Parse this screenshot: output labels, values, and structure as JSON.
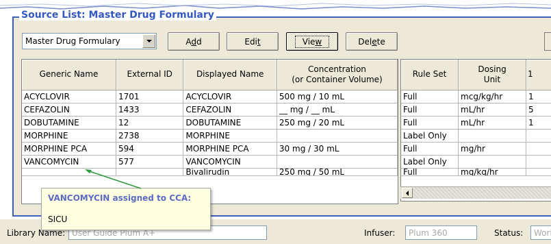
{
  "group_title": "Source List: Master Drug Formulary",
  "source_select": {
    "value": "Master Drug Formulary"
  },
  "buttons": {
    "add": {
      "pre": "A",
      "key": "d",
      "post": "d"
    },
    "edit": {
      "pre": "Edi",
      "key": "t",
      "post": ""
    },
    "view": {
      "pre": "Vie",
      "key": "w",
      "post": ""
    },
    "delete": {
      "pre": "Del",
      "key": "e",
      "post": "te"
    }
  },
  "left_table": {
    "headers": [
      "Generic Name",
      "External ID",
      "Displayed Name",
      "Concentration\n(or Container Volume)"
    ],
    "rows": [
      [
        "ACYCLOVIR",
        "1701",
        "ACYCLOVIR",
        "500 mg / 10 mL"
      ],
      [
        "CEFAZOLIN",
        "1433",
        "CEFAZOLIN",
        "__ mg / __ mL"
      ],
      [
        "DOBUTAMINE",
        "12",
        "DOBUTAMINE",
        "250 mg / 20 mL"
      ],
      [
        "MORPHINE",
        "2738",
        "MORPHINE",
        ""
      ],
      [
        "MORPHINE PCA",
        "594",
        "MORPHINE PCA",
        "30 mg / 30 mL"
      ],
      [
        "VANCOMYCIN",
        "577",
        "VANCOMYCIN",
        ""
      ],
      [
        "",
        "",
        "Bivalirudin",
        "250 mg / 50 mL"
      ]
    ]
  },
  "right_table": {
    "headers": [
      "Rule Set",
      "Dosing\nUnit",
      "1"
    ],
    "rows": [
      [
        "Full",
        "mcg/kg/hr",
        "1"
      ],
      [
        "Full",
        "mL/hr",
        "5"
      ],
      [
        "Full",
        "mL/hr",
        "1"
      ],
      [
        "Label Only",
        "",
        ""
      ],
      [
        "Full",
        "mg/hr",
        ""
      ],
      [
        "Label Only",
        "",
        ""
      ],
      [
        "Full",
        "mg/kg/hr",
        ""
      ]
    ]
  },
  "tooltip": {
    "title": "VANCOMYCIN assigned to CCA:",
    "body": "SICU"
  },
  "status": {
    "library_label": "Library Name:",
    "library_value": "User Guide Plum A+",
    "infuser_label": "Infuser:",
    "infuser_value": "Plum 360",
    "status_label": "Status:",
    "status_value": "Working"
  },
  "colors": {
    "group_border": "#3f62b9",
    "group_title": "#3559c2",
    "tooltip_bg": "#ffffe1",
    "tooltip_title": "#5b6cc2",
    "arrow": "#2e9a3e"
  }
}
